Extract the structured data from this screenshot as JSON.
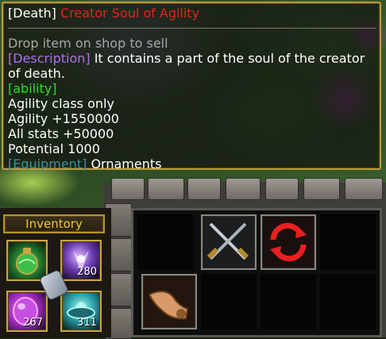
{
  "tooltip": {
    "tag": "[Death]",
    "name": "Creator Soul of Agility",
    "hint": "Drop item on shop to sell",
    "description_tag": "[Description]",
    "description": "It contains a part of the soul of the creator of death.",
    "ability_tag": "[ability]",
    "stats": [
      "Agility class only",
      "Agility +1550000",
      "All stats +50000",
      "Potential 1000"
    ],
    "equipment_tag": "[Equipment]",
    "equipment": "Ornaments"
  },
  "inventory": {
    "title": "Inventory",
    "slots": [
      {
        "icon": "green-potion-icon",
        "count": ""
      },
      {
        "icon": "purple-fang-icon",
        "count": "280"
      },
      {
        "icon": "pink-orb-icon",
        "count": "267"
      },
      {
        "icon": "cyan-bowl-icon",
        "count": "311"
      }
    ],
    "cursor_icon": "gauntlet-cursor-icon"
  },
  "shop": {
    "slots": [
      {
        "icon": "crossed-swords-icon"
      },
      {
        "icon": "red-refresh-icon"
      },
      {
        "icon": "hand-holding-item-icon"
      }
    ]
  },
  "colors": {
    "item_name": "#e8231f",
    "hint": "#a8a8a8",
    "description_tag": "#b56cf0",
    "ability_tag": "#2bdc2b",
    "equipment_tag": "#3a90a8",
    "frame_gold": "#b99a3a"
  }
}
